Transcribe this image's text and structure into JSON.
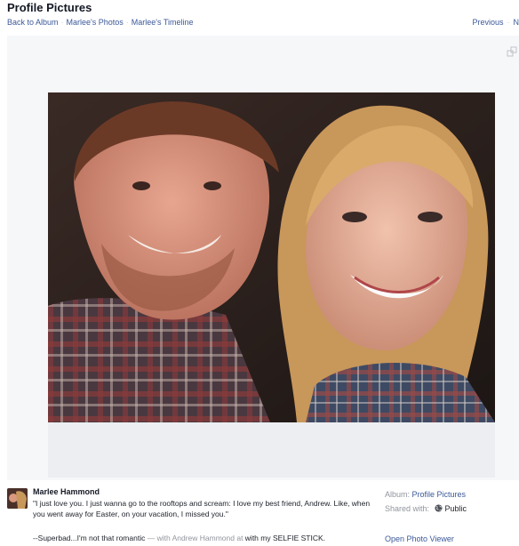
{
  "header": {
    "title": "Profile Pictures",
    "breadcrumb": [
      "Back to Album",
      "Marlee's Photos",
      "Marlee's Timeline"
    ],
    "previous_label": "Previous",
    "next_label": "N"
  },
  "post": {
    "author": "Marlee Hammond",
    "quote": "\"I just love you. I just wanna go to the rooftops and scream: I love my best friend, Andrew. Like, when you went away for Easter, on your vacation, I missed you.\"",
    "signature": "--Superbad...I'm not that romantic",
    "with_prefix": " — with ",
    "tagged": "Andrew Hammond",
    "at_prefix": " at ",
    "place": "with my SELFIE STICK."
  },
  "sidebar": {
    "album_label": "Album: ",
    "album_name": "Profile Pictures",
    "shared_label": "Shared with:",
    "privacy": "Public",
    "open_viewer": "Open Photo Viewer"
  },
  "icons": {
    "expand": "expand-icon",
    "privacy": "globe-icon"
  },
  "colors": {
    "link": "#3b5998",
    "stage_bg": "#f6f7f9",
    "muted": "#90949c"
  }
}
